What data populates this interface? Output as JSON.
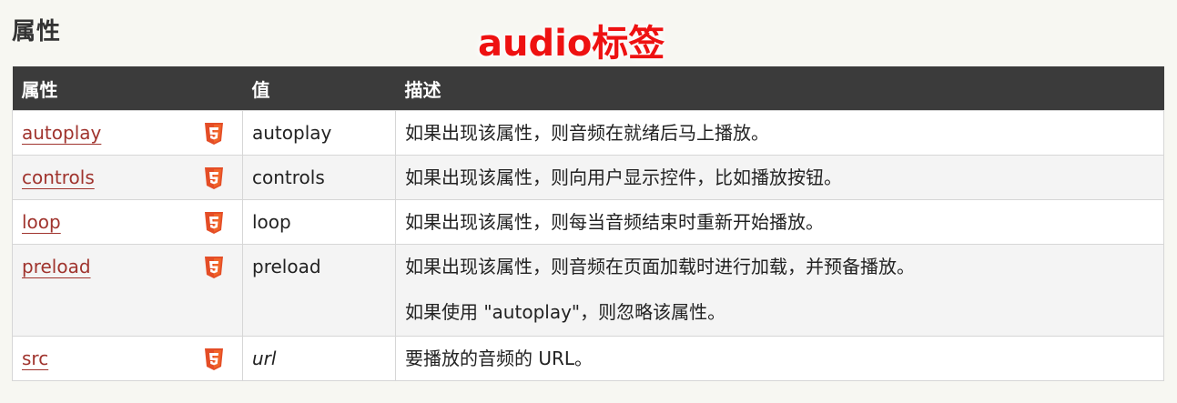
{
  "section_title": "属性",
  "overlay_title": "audio标签",
  "table": {
    "headers": {
      "attribute": "属性",
      "value": "值",
      "description": "描述"
    },
    "rows": [
      {
        "attribute": "autoplay",
        "value": "autoplay",
        "description": [
          "如果出现该属性，则音频在就绪后马上播放。"
        ]
      },
      {
        "attribute": "controls",
        "value": "controls",
        "description": [
          "如果出现该属性，则向用户显示控件，比如播放按钮。"
        ]
      },
      {
        "attribute": "loop",
        "value": "loop",
        "description": [
          "如果出现该属性，则每当音频结束时重新开始播放。"
        ]
      },
      {
        "attribute": "preload",
        "value": "preload",
        "description": [
          "如果出现该属性，则音频在页面加载时进行加载，并预备播放。",
          "如果使用 \"autoplay\"，则忽略该属性。"
        ]
      },
      {
        "attribute": "src",
        "value": "url",
        "description": [
          "要播放的音频的 URL。"
        ]
      }
    ]
  },
  "icons": {
    "html5": "html5-icon"
  },
  "colors": {
    "header_bg": "#3b3b3b",
    "link": "#a0342e",
    "overlay_title": "#ee1111",
    "html5_icon": "#e44d26"
  }
}
